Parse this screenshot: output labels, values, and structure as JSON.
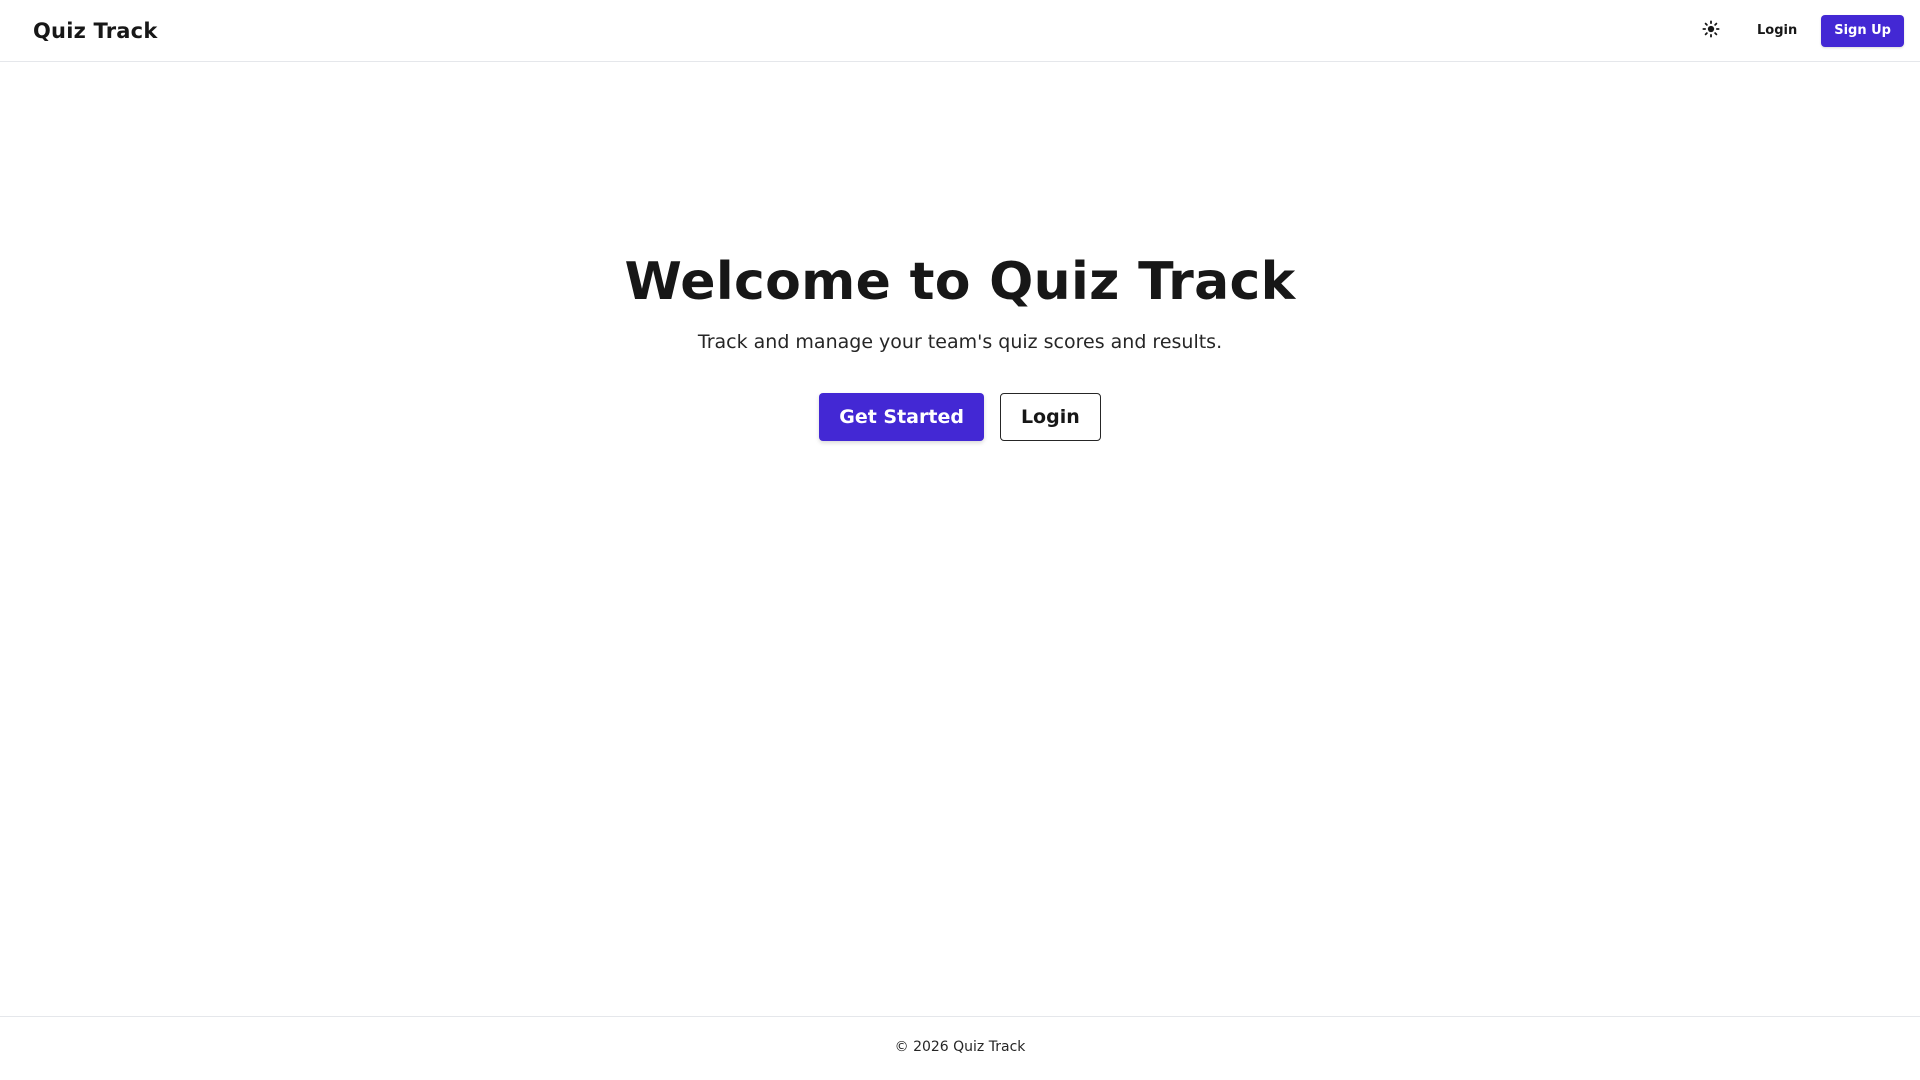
{
  "header": {
    "brand": "Quiz Track",
    "theme_toggle_icon": "sun-icon",
    "login_label": "Login",
    "signup_label": "Sign Up"
  },
  "hero": {
    "title": "Welcome to Quiz Track",
    "subtitle": "Track and manage your team's quiz scores and results.",
    "primary_cta": "Get Started",
    "secondary_cta": "Login"
  },
  "footer": {
    "copyright": "© 2026 Quiz Track"
  },
  "colors": {
    "accent": "#4328d4",
    "text": "#171717",
    "border": "#e5e7eb",
    "background": "#ffffff"
  }
}
